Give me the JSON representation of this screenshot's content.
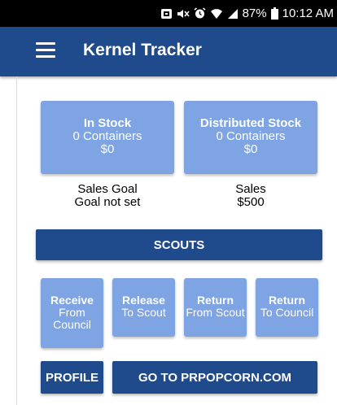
{
  "status_bar": {
    "battery": "87%",
    "time": "10:12 AM",
    "icons": [
      "nfc-icon",
      "mute-icon",
      "alarm-icon",
      "wifi-icon",
      "signal-icon",
      "battery-icon"
    ]
  },
  "app_bar": {
    "title": "Kernel Tracker",
    "menu_icon": "hamburger-menu-icon"
  },
  "stock_cards": {
    "in_stock": {
      "title": "In Stock",
      "containers": "0 Containers",
      "value": "$0"
    },
    "distributed": {
      "title": "Distributed Stock",
      "containers": "0 Containers",
      "value": "$0"
    }
  },
  "sales_goal": {
    "label": "Sales Goal",
    "value": "Goal not set"
  },
  "sales": {
    "label": "Sales",
    "value": "$500"
  },
  "scouts_button": "SCOUTS",
  "actions": [
    {
      "title": "Receive",
      "line1": "From",
      "line2": "Council"
    },
    {
      "title": "Release",
      "line1": "To Scout"
    },
    {
      "title": "Return",
      "line1": "From Scout"
    },
    {
      "title": "Return",
      "line1": "To Council"
    }
  ],
  "bottom": {
    "profile": "PROFILE",
    "website": "GO TO PRPOPCORN.COM"
  },
  "colors": {
    "primary": "#1f4a8c",
    "card": "#7fa4e3",
    "status_bar": "#000000"
  }
}
